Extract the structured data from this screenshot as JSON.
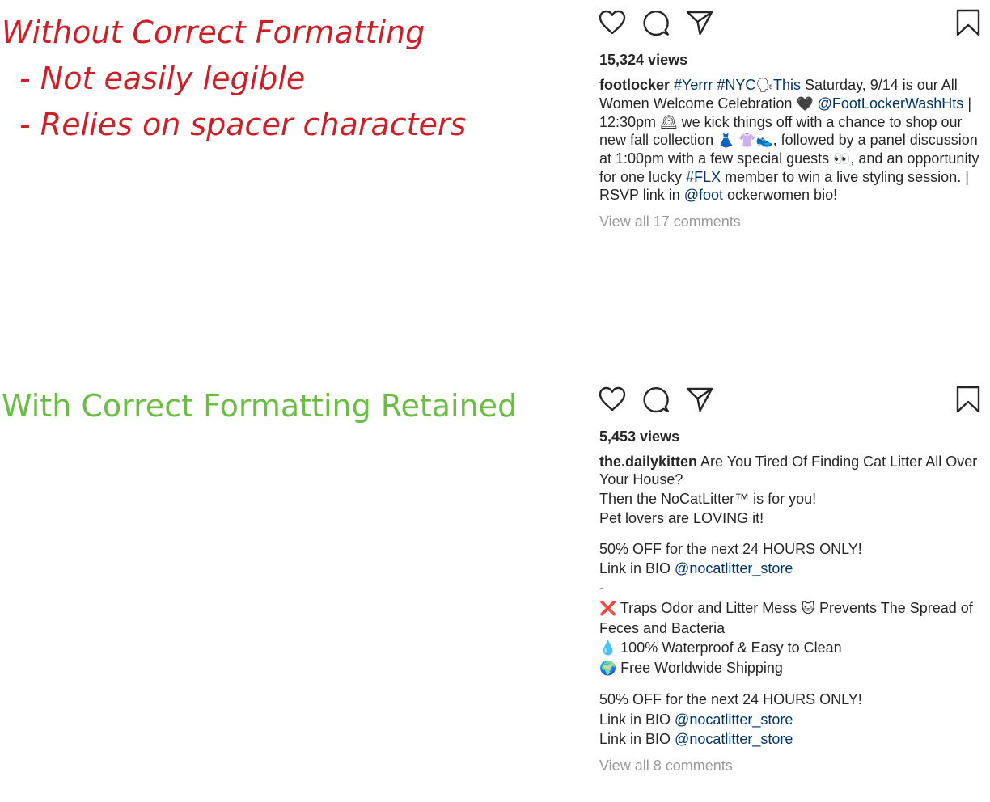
{
  "annotations": {
    "bad": {
      "title": "Without Correct Formatting",
      "points": [
        "- Not easily legible",
        "- Relies on spacer characters"
      ]
    },
    "good": {
      "title": "With Correct Formatting Retained"
    }
  },
  "colors": {
    "bad": "#cc1f27",
    "good": "#6cbd45",
    "link": "#003569",
    "muted": "#999999"
  },
  "icons": {
    "like": "heart-icon",
    "comment": "speech-bubble-icon",
    "share": "paper-plane-icon",
    "save": "bookmark-icon"
  },
  "post1": {
    "views": "15,324 views",
    "username": "footlocker",
    "caption": {
      "tag_yerrr": "#Yerrr",
      "tag_nyc": "#NYC",
      "emoji_speaking": "🗣",
      "word_this": "This",
      "text_a": " Saturday, 9/14 is our All Women Welcome Celebration ",
      "emoji_heart": "🖤",
      "mention_washhts": "@FootLockerWashHts",
      "text_b": " | 12:30pm ",
      "emoji_clock": "🕰",
      "text_c": " we kick things off with a chance to shop our new fall collection ",
      "emoji_dress": "👗",
      "emoji_shirt": "👚",
      "emoji_shoe": "👟",
      "text_d": ", followed by a panel discussion at 1:00pm with a few special guests ",
      "emoji_eyes": "👀",
      "text_e": ", and an opportunity for one lucky ",
      "tag_flx": "#FLX",
      "text_f": " member to win a live styling session. | RSVP link in ",
      "mention_foot": "@foot",
      "text_g": " ockerwomen bio!"
    },
    "view_comments": "View all 17 comments"
  },
  "post2": {
    "views": "5,453 views",
    "username": "the.dailykitten",
    "caption": {
      "line1": " Are You Tired Of Finding Cat Litter All Over Your House?",
      "line2": "Then the NoCatLitter™ is for you!",
      "line3": "Pet lovers are LOVING it!",
      "line4": "50% OFF for the next 24 HOURS ONLY!",
      "link_prefix": "Link in BIO ",
      "mention_store": "@nocatlitter_store",
      "dash": "-",
      "emoji_x": "❌",
      "bullet1": " Traps Odor and Litter Mess ",
      "emoji_cat": "🐱",
      "bullet1b": " Prevents The Spread of Feces and Bacteria",
      "emoji_drop": "💧",
      "bullet2": " 100% Waterproof & Easy to Clean",
      "emoji_globe": "🌍",
      "bullet3": " Free Worldwide Shipping",
      "line5": "50% OFF for the next 24 HOURS ONLY!"
    },
    "view_comments": "View all 8 comments"
  }
}
